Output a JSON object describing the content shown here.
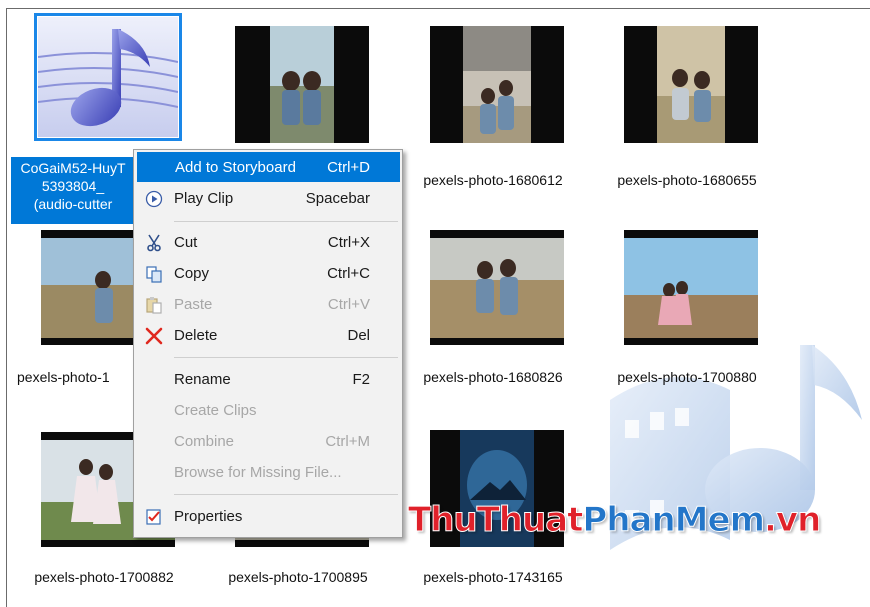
{
  "items": [
    {
      "caption": "CoGaiM52-HuyT",
      "caption_line2": "5393804_",
      "caption_line3": "(audio-cutter",
      "kind": "audio",
      "selected": true
    },
    {
      "caption": "",
      "kind": "photo-portrait"
    },
    {
      "caption": "pexels-photo-1680612",
      "kind": "photo-portrait"
    },
    {
      "caption": "pexels-photo-1680655",
      "kind": "photo-portrait"
    },
    {
      "caption": "pexels-photo-1",
      "kind": "photo-landscape"
    },
    {
      "caption": "",
      "kind": "photo-landscape"
    },
    {
      "caption": "pexels-photo-1680826",
      "kind": "photo-landscape"
    },
    {
      "caption": "pexels-photo-1700880",
      "kind": "photo-landscape"
    },
    {
      "caption": "pexels-photo-1700882",
      "kind": "photo-landscape"
    },
    {
      "caption": "pexels-photo-1700895",
      "kind": "photo-landscape"
    },
    {
      "caption": "pexels-photo-1743165",
      "kind": "photo-portrait-blue"
    }
  ],
  "context_menu": {
    "items": [
      {
        "label": "Add to Storyboard",
        "shortcut": "Ctrl+D",
        "icon": "",
        "state": "highlighted"
      },
      {
        "label": "Play Clip",
        "shortcut": "Spacebar",
        "icon": "play-icon",
        "state": "enabled"
      },
      {
        "label": "Cut",
        "shortcut": "Ctrl+X",
        "icon": "scissors-icon",
        "state": "enabled"
      },
      {
        "label": "Copy",
        "shortcut": "Ctrl+C",
        "icon": "copy-icon",
        "state": "enabled"
      },
      {
        "label": "Paste",
        "shortcut": "Ctrl+V",
        "icon": "paste-icon",
        "state": "disabled"
      },
      {
        "label": "Delete",
        "shortcut": "Del",
        "icon": "delete-x-icon",
        "state": "enabled"
      },
      {
        "label": "Rename",
        "shortcut": "F2",
        "icon": "",
        "state": "enabled"
      },
      {
        "label": "Create Clips",
        "shortcut": "",
        "icon": "",
        "state": "disabled"
      },
      {
        "label": "Combine",
        "shortcut": "Ctrl+M",
        "icon": "",
        "state": "disabled"
      },
      {
        "label": "Browse for Missing File...",
        "shortcut": "",
        "icon": "",
        "state": "disabled"
      },
      {
        "label": "Properties",
        "shortcut": "",
        "icon": "properties-icon",
        "state": "enabled"
      }
    ]
  },
  "watermark": {
    "part1": "ThuThuat",
    "part2": "PhanMem",
    "part3": ".vn"
  },
  "colors": {
    "selection": "#0078d7",
    "menu_bg": "#f2f2f2",
    "brand_red": "#e0212a",
    "brand_blue": "#2376c9"
  }
}
